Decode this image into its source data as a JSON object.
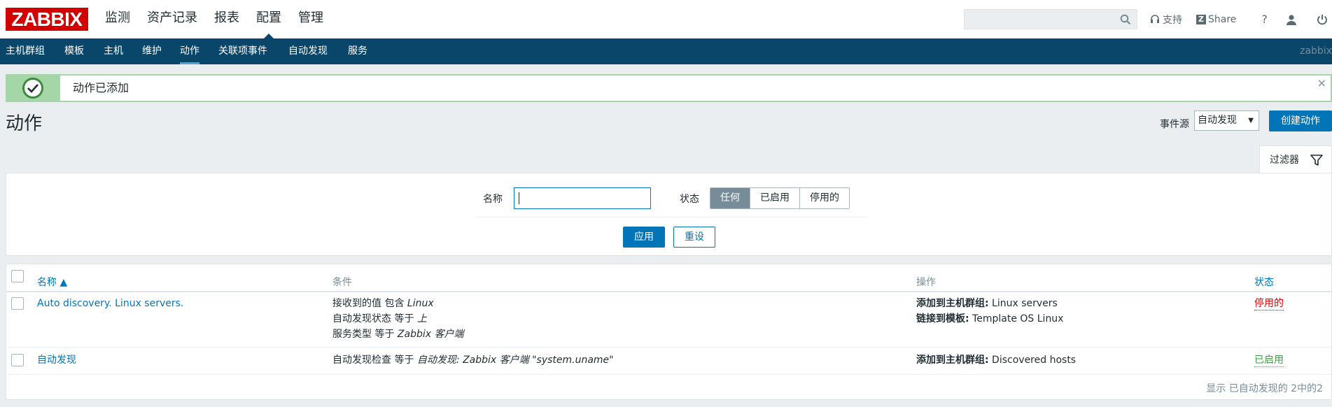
{
  "header": {
    "logo": "ZABBIX",
    "main_nav": [
      "监测",
      "资产记录",
      "报表",
      "配置",
      "管理"
    ],
    "active_main": "配置",
    "search": {
      "placeholder": "",
      "value": ""
    },
    "support": "支持",
    "share": "Share",
    "help": "?"
  },
  "subnav": {
    "items": [
      "主机群组",
      "模板",
      "主机",
      "维护",
      "动作",
      "关联项事件",
      "自动发现",
      "服务"
    ],
    "active": "动作",
    "user": "zabbix"
  },
  "message": {
    "text": "动作已添加",
    "close": "×"
  },
  "page": {
    "title": "动作",
    "event_source_label": "事件源",
    "event_source_value": "自动发现",
    "create_button": "创建动作"
  },
  "filter": {
    "tab_label": "过滤器",
    "name_label": "名称",
    "name_value": "",
    "status_label": "状态",
    "status_options": [
      "任何",
      "已启用",
      "停用的"
    ],
    "status_selected": "任何",
    "apply": "应用",
    "reset": "重设"
  },
  "table": {
    "headers": {
      "name": "名称 ▲",
      "conditions": "条件",
      "operations": "操作",
      "status": "状态"
    },
    "rows": [
      {
        "name": "Auto discovery. Linux servers.",
        "conditions": [
          {
            "prefix": "接收到的值 包含 ",
            "value": "Linux"
          },
          {
            "prefix": "自动发现状态 等于 ",
            "value": "上"
          },
          {
            "prefix": "服务类型 等于 ",
            "value": "Zabbix 客户端"
          }
        ],
        "operations": [
          {
            "label": "添加到主机群组:",
            "value": " Linux servers"
          },
          {
            "label": "链接到模板:",
            "value": " Template OS Linux"
          }
        ],
        "status": "停用的"
      },
      {
        "name": "自动发现",
        "conditions": [
          {
            "prefix": "自动发现检查 等于 ",
            "value": "自动发现: Zabbix 客户端 \"system.uname\""
          }
        ],
        "operations": [
          {
            "label": "添加到主机群组:",
            "value": " Discovered hosts"
          }
        ],
        "status": "已启用"
      }
    ],
    "footer": "显示 已自动发现的 2中的2"
  },
  "colors": {
    "brand_red": "#d40000",
    "nav_dark": "#0a466a",
    "accent_blue": "#0275b8",
    "success_green": "#a5d6a7",
    "status_disabled": "#dc0000",
    "status_enabled": "#429e47"
  }
}
